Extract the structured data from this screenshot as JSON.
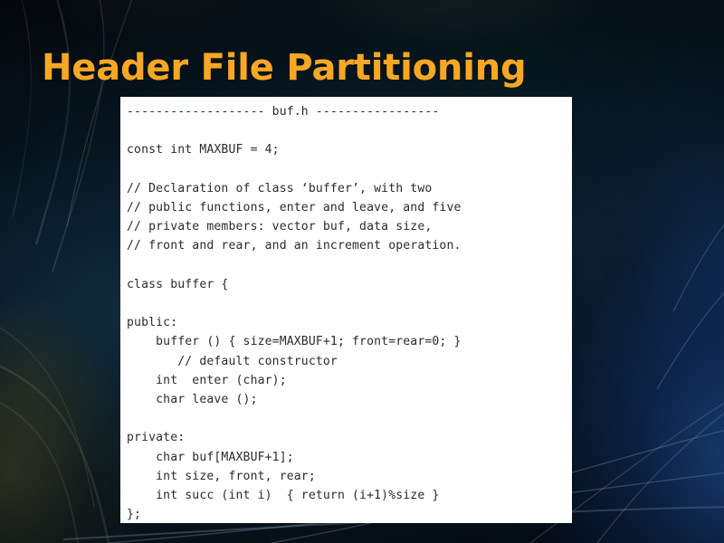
{
  "slide": {
    "title": "Header File Partitioning",
    "title_color": "#f7a723",
    "background_color": "#07161f",
    "panel_background": "#ffffff",
    "code_text_color": "#2b2b2b"
  },
  "code_panel": {
    "language": "cpp",
    "filename": "buf.h",
    "lines": [
      "------------------- buf.h -----------------",
      "",
      "const int MAXBUF = 4;",
      "",
      "// Declaration of class ‘buffer’, with two",
      "// public functions, enter and leave, and five",
      "// private members: vector buf, data size,",
      "// front and rear, and an increment operation.",
      "",
      "class buffer {",
      "",
      "public:",
      "    buffer () { size=MAXBUF+1; front=rear=0; }",
      "       // default constructor",
      "    int  enter (char);",
      "    char leave ();",
      "",
      "private:",
      "    char buf[MAXBUF+1];",
      "    int size, front, rear;",
      "    int succ (int i)  { return (i+1)%size }",
      "};"
    ],
    "text": "------------------- buf.h -----------------\n\nconst int MAXBUF = 4;\n\n// Declaration of class ‘buffer’, with two\n// public functions, enter and leave, and five\n// private members: vector buf, data size,\n// front and rear, and an increment operation.\n\nclass buffer {\n\npublic:\n    buffer () { size=MAXBUF+1; front=rear=0; }\n       // default constructor\n    int  enter (char);\n    char leave ();\n\nprivate:\n    char buf[MAXBUF+1];\n    int size, front, rear;\n    int succ (int i)  { return (i+1)%size }\n};"
  }
}
